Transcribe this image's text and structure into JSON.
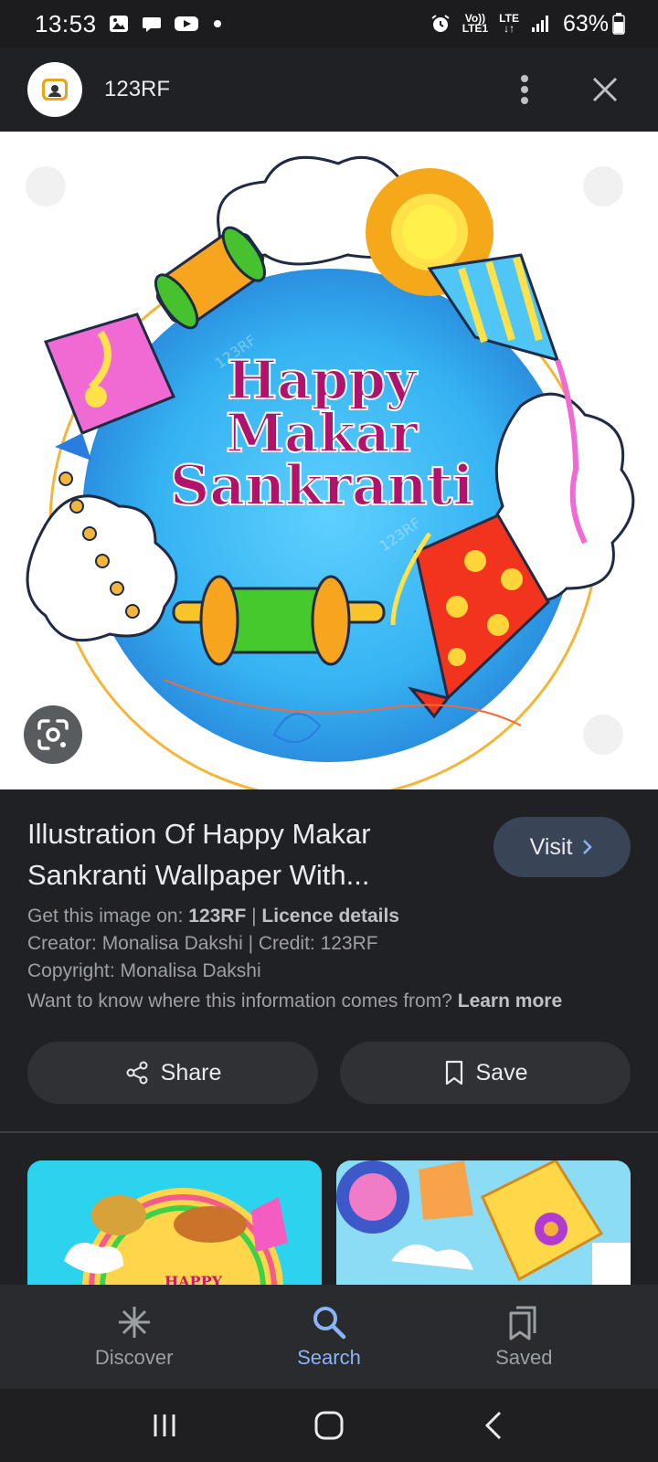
{
  "status_bar": {
    "time": "13:53",
    "network_top": "Vo))",
    "network_bottom": "LTE1",
    "lte": "LTE",
    "battery": "63%"
  },
  "header": {
    "site_name": "123RF"
  },
  "image": {
    "headline_line1": "Happy",
    "headline_line2": "Makar",
    "headline_line3": "Sankranti",
    "watermark": "123RF"
  },
  "info": {
    "title": "Illustration Of Happy Makar Sankranti Wallpaper With...",
    "visit_label": "Visit",
    "get_image_prefix": "Get this image on: ",
    "get_image_source": "123RF",
    "separator": " | ",
    "licence_details": "Licence details",
    "creator_credit": "Creator: Monalisa Dakshi | Credit: 123RF",
    "copyright": "Copyright: Monalisa Dakshi",
    "why_text": "Want to know where this information comes from? ",
    "learn_more": "Learn more"
  },
  "actions": {
    "share_label": "Share",
    "save_label": "Save"
  },
  "related": {
    "thumb1_text": "HAPPY"
  },
  "bottom_nav": {
    "discover": "Discover",
    "search": "Search",
    "saved": "Saved"
  },
  "colors": {
    "background": "#202124",
    "accent": "#8ab4f8",
    "visit_button": "#394457",
    "action_button": "#303134"
  }
}
